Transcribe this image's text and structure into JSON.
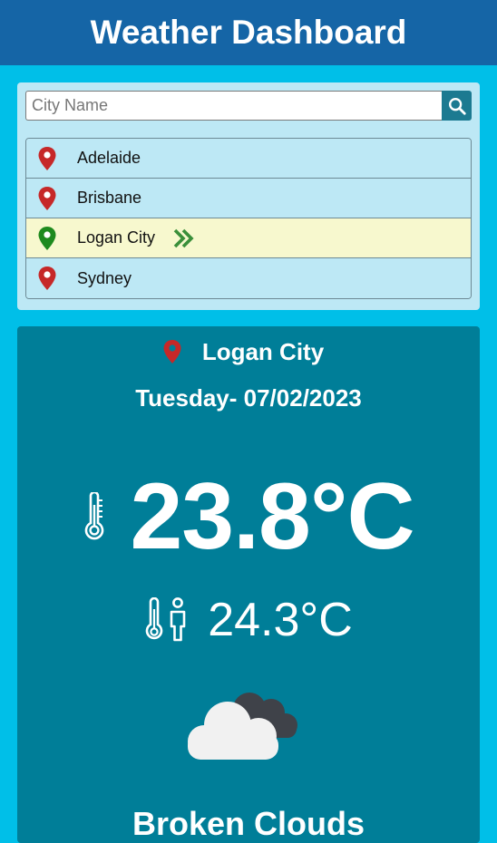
{
  "header": {
    "title": "Weather Dashboard"
  },
  "search": {
    "placeholder": "City Name",
    "value": ""
  },
  "cities": [
    {
      "label": "Adelaide",
      "active": false
    },
    {
      "label": "Brisbane",
      "active": false
    },
    {
      "label": "Logan City",
      "active": true
    },
    {
      "label": "Sydney",
      "active": false
    }
  ],
  "weather": {
    "city": "Logan City",
    "date": "Tuesday- 07/02/2023",
    "temperature": "23.8°C",
    "feels_like": "24.3°C",
    "condition": "Broken Clouds",
    "condition_icon": "broken-clouds-icon"
  },
  "icons": {
    "search": "search-icon",
    "pin": "map-pin-icon",
    "active_arrow": "double-chevron-right-icon",
    "thermometer": "thermometer-icon",
    "feels_like": "feels-like-icon"
  },
  "colors": {
    "header_bg": "#1565a6",
    "page_bg": "#00bfe8",
    "list_bg": "#bde8f5",
    "active_bg": "#f7f8ce",
    "pin_red": "#c62828",
    "pin_green": "#1e8a1e",
    "weather_bg": "#007e98",
    "search_button": "#1c7a91"
  }
}
